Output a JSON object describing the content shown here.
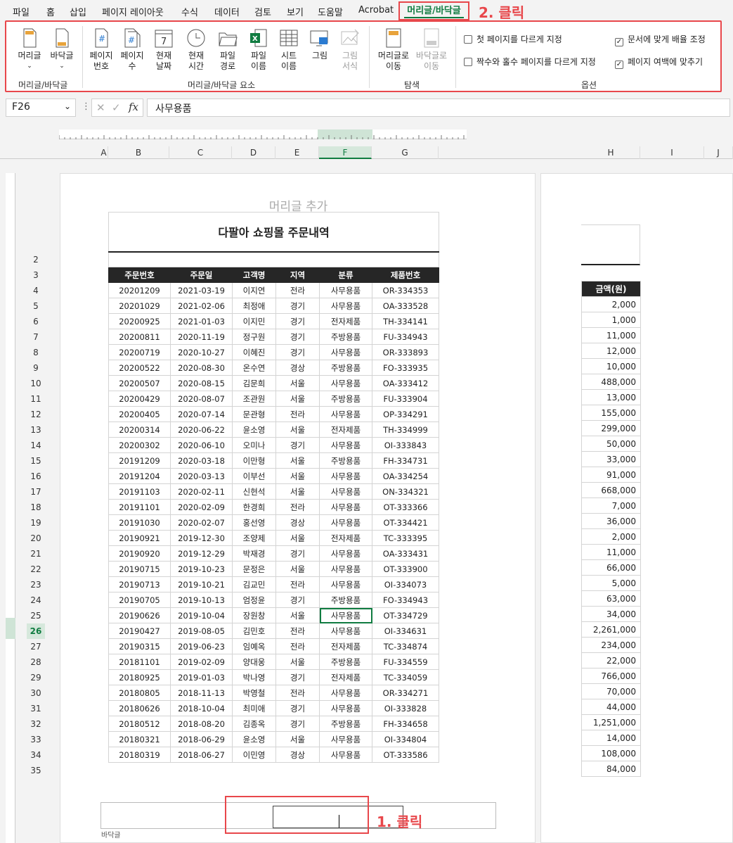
{
  "tabs": [
    "파일",
    "홈",
    "삽입",
    "페이지 레이아웃",
    "수식",
    "데이터",
    "검토",
    "보기",
    "도움말",
    "Acrobat"
  ],
  "active_tab": "머리글/바닥글",
  "annotations": {
    "step2": "2. 클릭",
    "step1": "1. 클릭"
  },
  "ribbon": {
    "header": "머리글",
    "footer": "바닥글",
    "page_number": "페이지\n번호",
    "page_count": "페이지\n수",
    "current_date": "현재\n날짜",
    "current_time": "현재\n시간",
    "file_path": "파일\n경로",
    "file_name": "파일\n이름",
    "sheet_name": "시트\n이름",
    "picture": "그림",
    "format_picture": "그림\n서식",
    "goto_header": "머리글로\n이동",
    "goto_footer": "바닥글로\n이동",
    "group_hf": "머리글/바닥글",
    "group_elements": "머리글/바닥글 요소",
    "group_nav": "탐색",
    "group_options": "옵션",
    "opt_first": "첫 페이지를 다르게 지정",
    "opt_oddeven": "짝수와 홀수 페이지를 다르게 지정",
    "opt_scale": "문서에 맞게 배율 조정",
    "opt_margins": "페이지 여백에 맞추기"
  },
  "formula": {
    "namebox": "F26",
    "fx": "fx",
    "content": "사무용품"
  },
  "columns": [
    "A",
    "B",
    "C",
    "D",
    "E",
    "F",
    "G",
    "H",
    "I",
    "J"
  ],
  "rows": [
    2,
    3,
    4,
    5,
    6,
    7,
    8,
    9,
    10,
    11,
    12,
    13,
    14,
    15,
    16,
    17,
    18,
    19,
    20,
    21,
    22,
    23,
    24,
    25,
    26,
    27,
    28,
    29,
    30,
    31,
    32,
    33,
    34,
    35
  ],
  "header_placeholder": "머리글 추가",
  "title": "다팔아 쇼핑몰 주문내역",
  "table_headers": [
    "주문번호",
    "주문일",
    "고객명",
    "지역",
    "분류",
    "제품번호"
  ],
  "amount_header": "금액(원)",
  "table_rows": [
    [
      "20201209",
      "2021-03-19",
      "이지연",
      "전라",
      "사무용품",
      "OR-334353",
      "2,000"
    ],
    [
      "20201029",
      "2021-02-06",
      "최정애",
      "경기",
      "사무용품",
      "OA-333528",
      "1,000"
    ],
    [
      "20200925",
      "2021-01-03",
      "이지민",
      "경기",
      "전자제품",
      "TH-334141",
      "11,000"
    ],
    [
      "20200811",
      "2020-11-19",
      "정구원",
      "경기",
      "주방용품",
      "FU-334943",
      "12,000"
    ],
    [
      "20200719",
      "2020-10-27",
      "이혜진",
      "경기",
      "사무용품",
      "OR-333893",
      "10,000"
    ],
    [
      "20200522",
      "2020-08-30",
      "온수연",
      "경상",
      "주방용품",
      "FO-333935",
      "488,000"
    ],
    [
      "20200507",
      "2020-08-15",
      "김문희",
      "서울",
      "사무용품",
      "OA-333412",
      "13,000"
    ],
    [
      "20200429",
      "2020-08-07",
      "조관원",
      "서울",
      "주방용품",
      "FU-333904",
      "155,000"
    ],
    [
      "20200405",
      "2020-07-14",
      "문관형",
      "전라",
      "사무용품",
      "OP-334291",
      "299,000"
    ],
    [
      "20200314",
      "2020-06-22",
      "윤소영",
      "서울",
      "전자제품",
      "TH-334999",
      "50,000"
    ],
    [
      "20200302",
      "2020-06-10",
      "오미나",
      "경기",
      "사무용품",
      "OI-333843",
      "33,000"
    ],
    [
      "20191209",
      "2020-03-18",
      "이만형",
      "서울",
      "주방용품",
      "FH-334731",
      "91,000"
    ],
    [
      "20191204",
      "2020-03-13",
      "이부선",
      "서울",
      "사무용품",
      "OA-334254",
      "668,000"
    ],
    [
      "20191103",
      "2020-02-11",
      "신현석",
      "서울",
      "사무용품",
      "ON-334321",
      "7,000"
    ],
    [
      "20191101",
      "2020-02-09",
      "한경희",
      "전라",
      "사무용품",
      "OT-333366",
      "36,000"
    ],
    [
      "20191030",
      "2020-02-07",
      "홍선영",
      "경상",
      "사무용품",
      "OT-334421",
      "2,000"
    ],
    [
      "20190921",
      "2019-12-30",
      "조양제",
      "서울",
      "전자제품",
      "TC-333395",
      "11,000"
    ],
    [
      "20190920",
      "2019-12-29",
      "박재경",
      "경기",
      "사무용품",
      "OA-333431",
      "66,000"
    ],
    [
      "20190715",
      "2019-10-23",
      "문정은",
      "서울",
      "사무용품",
      "OT-333900",
      "5,000"
    ],
    [
      "20190713",
      "2019-10-21",
      "김교민",
      "전라",
      "사무용품",
      "OI-334073",
      "63,000"
    ],
    [
      "20190705",
      "2019-10-13",
      "엄정윤",
      "경기",
      "주방용품",
      "FO-334943",
      "34,000"
    ],
    [
      "20190626",
      "2019-10-04",
      "장원창",
      "서울",
      "사무용품",
      "OT-334729",
      "2,261,000"
    ],
    [
      "20190427",
      "2019-08-05",
      "김민호",
      "전라",
      "사무용품",
      "OI-334631",
      "234,000"
    ],
    [
      "20190315",
      "2019-06-23",
      "임예옥",
      "전라",
      "전자제품",
      "TC-334874",
      "22,000"
    ],
    [
      "20181101",
      "2019-02-09",
      "양대웅",
      "서울",
      "주방용품",
      "FU-334559",
      "766,000"
    ],
    [
      "20180925",
      "2019-01-03",
      "박나영",
      "경기",
      "전자제품",
      "TC-334059",
      "70,000"
    ],
    [
      "20180805",
      "2018-11-13",
      "박영철",
      "전라",
      "사무용품",
      "OR-334271",
      "44,000"
    ],
    [
      "20180626",
      "2018-10-04",
      "최미애",
      "경기",
      "사무용품",
      "OI-333828",
      "1,251,000"
    ],
    [
      "20180512",
      "2018-08-20",
      "김종옥",
      "경기",
      "주방용품",
      "FH-334658",
      "14,000"
    ],
    [
      "20180321",
      "2018-06-29",
      "윤소영",
      "서울",
      "사무용품",
      "OI-334804",
      "108,000"
    ],
    [
      "20180319",
      "2018-06-27",
      "이민영",
      "경상",
      "사무용품",
      "OT-333586",
      "84,000"
    ]
  ],
  "footer_label": "바닥글",
  "colors": {
    "accent": "#107c41",
    "annotation": "#e8474b"
  }
}
